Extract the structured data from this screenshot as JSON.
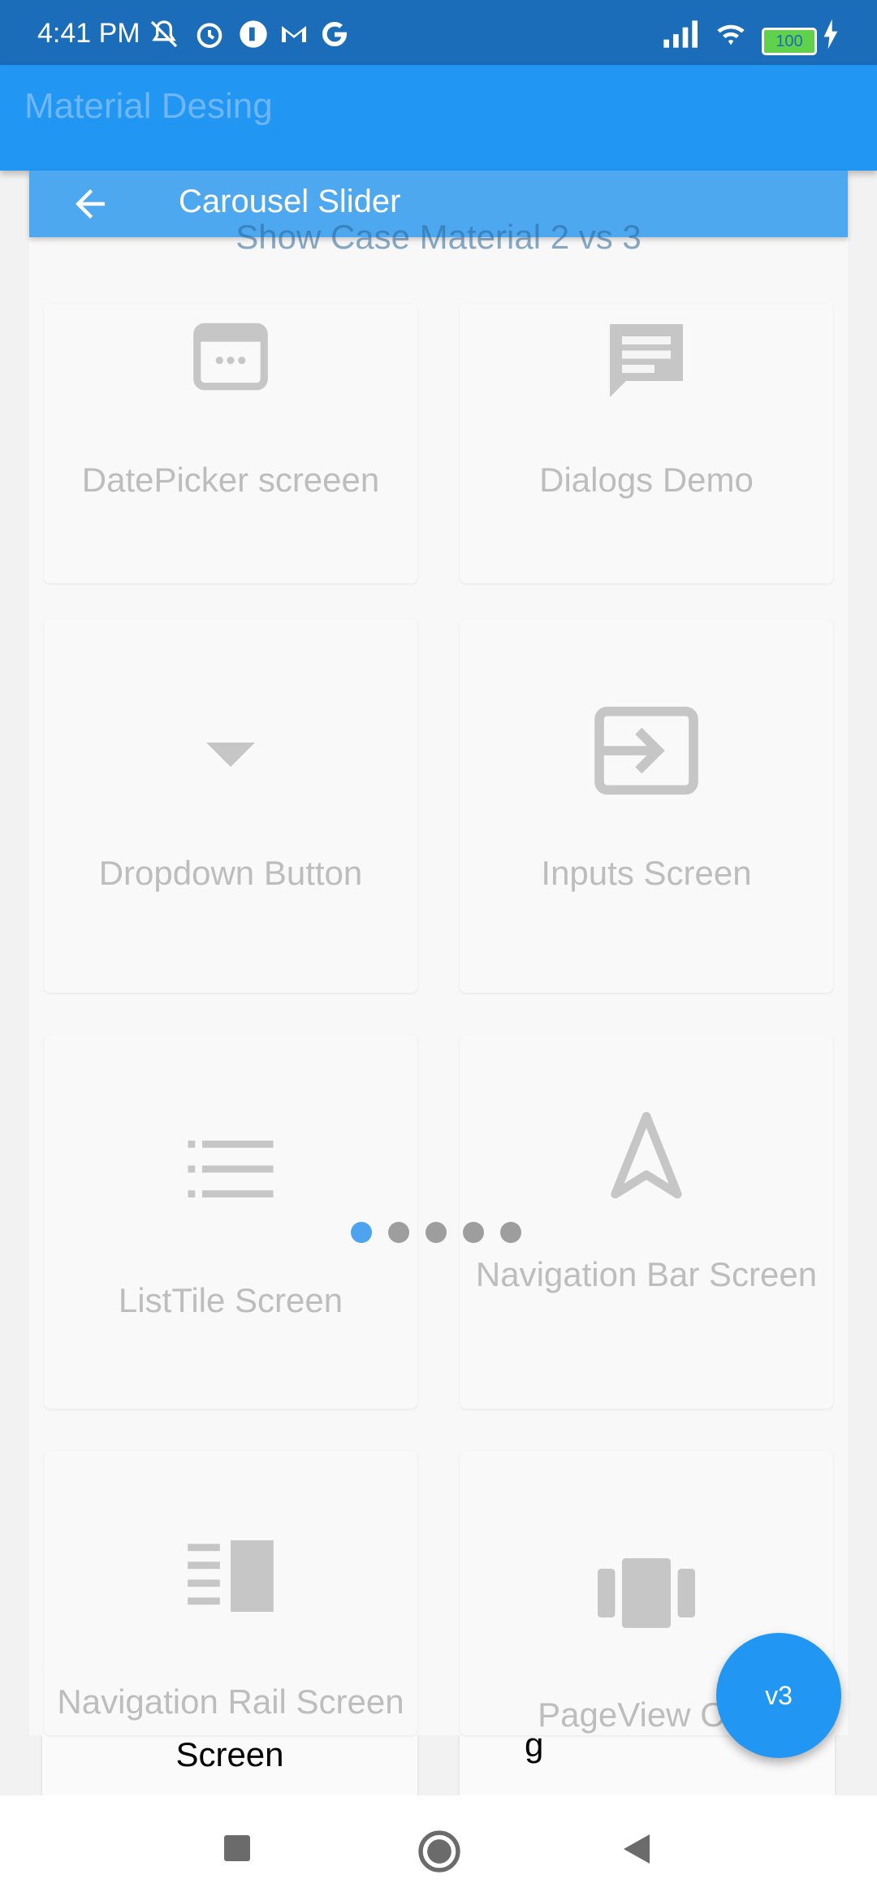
{
  "status_bar": {
    "time": "4:41 PM",
    "battery": "100"
  },
  "app_bar": {
    "title": "Material Desing"
  },
  "overlay": {
    "title": "Carousel Slider",
    "subtitle": "Show Case Material 2 vs 3"
  },
  "tiles": [
    {
      "label": "DatePicker screeen",
      "icon": "calendar-icon"
    },
    {
      "label": "Dialogs Demo",
      "icon": "message-icon"
    },
    {
      "label": "Dropdown Button",
      "icon": "dropdown-arrow-icon"
    },
    {
      "label": "Inputs Screen",
      "icon": "input-icon"
    },
    {
      "label": "ListTile Screen",
      "icon": "list-icon"
    },
    {
      "label": "Navigation Bar Screen",
      "icon": "navigation-icon"
    },
    {
      "label": "Navigation Rail Screen",
      "icon": "navigation-rail-icon"
    },
    {
      "label": "PageView Car",
      "icon": "carousel-icon"
    }
  ],
  "background_cards": [
    {
      "label": "Screen"
    },
    {
      "label": "g"
    }
  ],
  "carousel": {
    "page_count": 5,
    "active_index": 0
  },
  "fab": {
    "label": "v3"
  },
  "colors": {
    "primary": "#2196f3",
    "status_bar": "#1b6cb9",
    "overlay_header": "#4ea8f0"
  }
}
